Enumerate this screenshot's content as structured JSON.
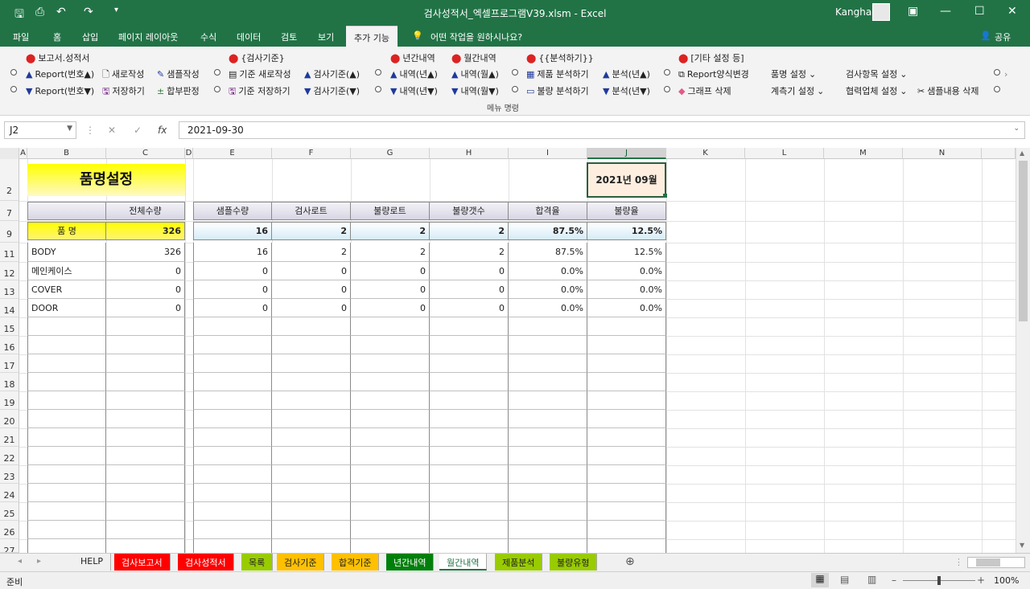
{
  "window": {
    "title": "검사성적서_엑셀프로그램V39.xlsm  -  Excel",
    "user": "Kangha"
  },
  "ribbon_tabs": [
    "파일",
    "홈",
    "삽입",
    "페이지 레이아웃",
    "수식",
    "데이터",
    "검토",
    "보기",
    "추가 기능"
  ],
  "tell_me": "어떤 작업을 원하시나요?",
  "share": "공유",
  "ribbon": {
    "group_label": "메뉴 명령",
    "sections": [
      "보고서.성적서",
      "{검사기준}",
      "년간내역",
      "월간내역",
      "{{분석하기}}",
      "[기타 설정 등]"
    ],
    "row1": [
      "Report(번호▲)",
      "새로작성",
      "샘플작성",
      "기준 새로작성",
      "검사기준(▲)",
      "내역(년▲)",
      "내역(월▲)",
      "제품 분석하기",
      "분석(년▲)",
      "Report양식변경",
      "품명 설정",
      "검사항목 설정"
    ],
    "row2": [
      "Report(번호▼)",
      "저장하기",
      "합부판정",
      "기준 저장하기",
      "검사기준(▼)",
      "내역(년▼)",
      "내역(월▼)",
      "불량 분석하기",
      "분석(년▼)",
      "그래프 삭제",
      "계측기 설정",
      "협력업체 설정",
      "샘플내용 삭제"
    ]
  },
  "formula_bar": {
    "name_box": "J2",
    "formula": "2021-09-30"
  },
  "columns": [
    "A",
    "B",
    "C",
    "D",
    "E",
    "F",
    "G",
    "H",
    "I",
    "J",
    "K",
    "L",
    "M",
    "N"
  ],
  "rows": [
    "2",
    "7",
    "9",
    "11",
    "12",
    "13",
    "14",
    "15",
    "16",
    "17",
    "18",
    "19",
    "20",
    "21",
    "22",
    "23",
    "24",
    "25",
    "26",
    "27"
  ],
  "sheet": {
    "title": "품명설정",
    "date_label": "2021년 09월",
    "headers": [
      "전체수량",
      "샘플수량",
      "검사로트",
      "불량로트",
      "불량갯수",
      "합격율",
      "불량율"
    ],
    "total_label": "품    명",
    "totals": [
      "326",
      "16",
      "2",
      "2",
      "2",
      "87.5%",
      "12.5%"
    ],
    "items": [
      {
        "name": "BODY",
        "values": [
          "326",
          "16",
          "2",
          "2",
          "2",
          "87.5%",
          "12.5%"
        ]
      },
      {
        "name": "메인케이스",
        "values": [
          "0",
          "0",
          "0",
          "0",
          "0",
          "0.0%",
          "0.0%"
        ]
      },
      {
        "name": "COVER",
        "values": [
          "0",
          "0",
          "0",
          "0",
          "0",
          "0.0%",
          "0.0%"
        ]
      },
      {
        "name": "DOOR",
        "values": [
          "0",
          "0",
          "0",
          "0",
          "0",
          "0.0%",
          "0.0%"
        ]
      }
    ]
  },
  "sheet_tabs": [
    {
      "label": "HELP",
      "color": "#f0f0f0",
      "text": "#222"
    },
    {
      "label": "검사보고서",
      "color": "#ff0000",
      "text": "#fff"
    },
    {
      "label": "검사성적서",
      "color": "#ff0000",
      "text": "#fff"
    },
    {
      "label": "목록",
      "color": "#99cc00",
      "text": "#222"
    },
    {
      "label": "검사기준",
      "color": "#ffc000",
      "text": "#222"
    },
    {
      "label": "합격기준",
      "color": "#ffc000",
      "text": "#222"
    },
    {
      "label": "년간내역",
      "color": "#00800a",
      "text": "#fff"
    },
    {
      "label": "월간내역",
      "color": "#ffffff",
      "text": "#217346"
    },
    {
      "label": "제품분석",
      "color": "#99cc00",
      "text": "#222"
    },
    {
      "label": "불량유형",
      "color": "#99cc00",
      "text": "#222"
    }
  ],
  "status": {
    "mode": "준비",
    "zoom": "100%"
  },
  "colors": {
    "excel_green": "#217346",
    "title_yellow": "#ffff00",
    "date_fill": "#fdeee0"
  }
}
